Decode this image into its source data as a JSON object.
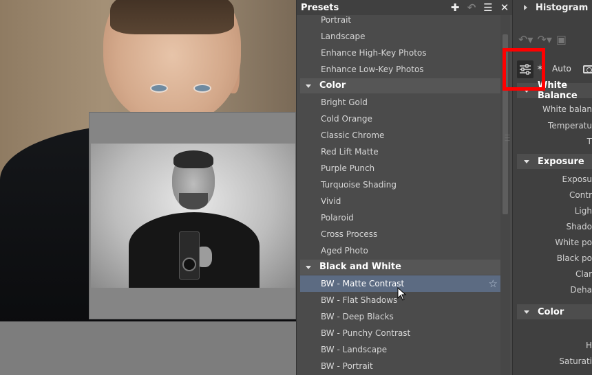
{
  "presets": {
    "title": "Presets",
    "items_before": [
      "Portrait",
      "Landscape",
      "Enhance High-Key Photos",
      "Enhance Low-Key Photos"
    ],
    "groups": [
      {
        "name": "Color",
        "items": [
          "Bright Gold",
          "Cold Orange",
          "Classic Chrome",
          "Red Lift Matte",
          "Purple Punch",
          "Turquoise Shading",
          "Vivid",
          "Polaroid",
          "Cross Process",
          "Aged Photo"
        ]
      },
      {
        "name": "Black and White",
        "items": [
          "BW - Matte Contrast",
          "BW - Flat Shadows",
          "BW - Deep Blacks",
          "BW - Punchy Contrast",
          "BW - Landscape",
          "BW - Portrait"
        ]
      }
    ],
    "selected": "BW - Matte Contrast"
  },
  "right_panel": {
    "histogram": "Histogram",
    "auto_label": "Auto",
    "sections": [
      {
        "name": "White Balance",
        "props": [
          "White balan",
          "Temperatu",
          "T"
        ]
      },
      {
        "name": "Exposure",
        "props": [
          "Exposu",
          "Contr",
          "Ligh",
          "Shado",
          "White po",
          "Black po",
          "Clar",
          "Deha"
        ]
      },
      {
        "name": "Color",
        "props": [
          "H",
          "Saturati"
        ]
      }
    ]
  },
  "colors": {
    "selection": "#5c6b82",
    "highlight": "#ff0000"
  }
}
